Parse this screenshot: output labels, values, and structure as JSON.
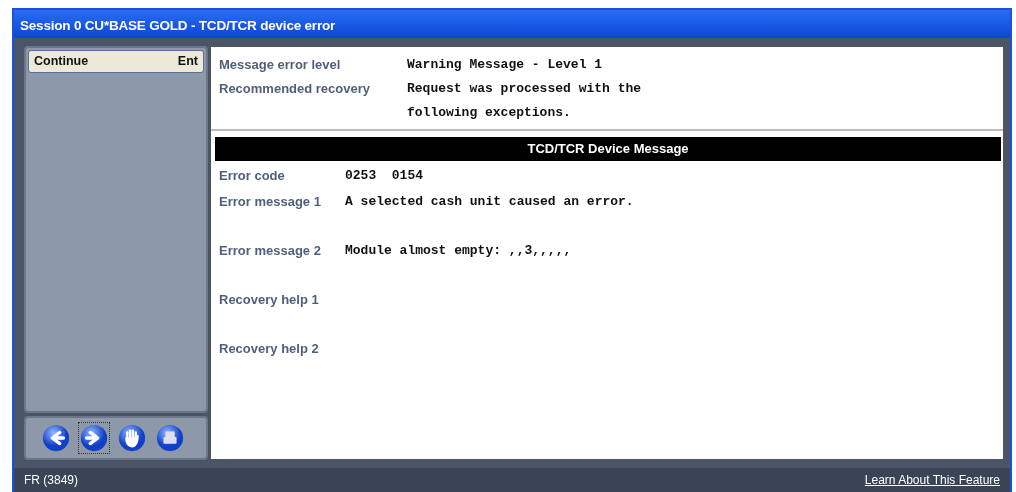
{
  "window": {
    "title": "Session 0 CU*BASE GOLD - TCD/TCR device error"
  },
  "actions": [
    {
      "label": "Continue",
      "key": "Ent"
    }
  ],
  "nav_buttons": [
    {
      "kind": "back",
      "focused": false
    },
    {
      "kind": "forward",
      "focused": true
    },
    {
      "kind": "hand",
      "focused": false
    },
    {
      "kind": "print",
      "focused": false
    }
  ],
  "summary": [
    {
      "label": "Message error level",
      "value": "Warning Message - Level 1"
    },
    {
      "label": "Recommended recovery",
      "value": "Request was processed with the following exceptions."
    }
  ],
  "section_title": "TCD/TCR Device Message",
  "details": [
    {
      "label": "Error code",
      "value": "0253  0154"
    },
    {
      "label": "Error message 1",
      "value": "A selected cash unit caused an error."
    },
    {
      "label": "Error message 2",
      "value": "Module almost empty: ,,3,,,,,"
    },
    {
      "label": "Recovery help 1"
    },
    {
      "label": "Recovery help 2"
    }
  ],
  "status_bar": {
    "text": "FR (3849)",
    "link": "Learn About This Feature"
  }
}
